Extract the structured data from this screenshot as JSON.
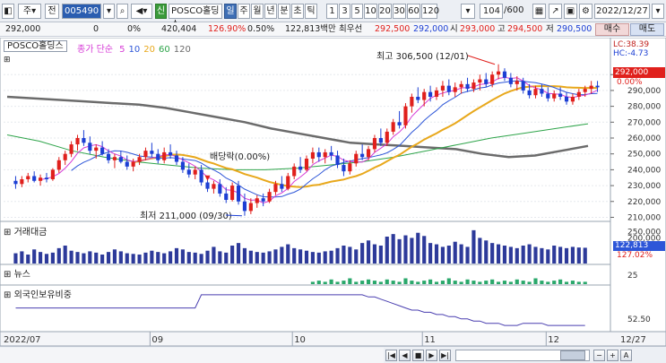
{
  "toolbar": {
    "market": "주",
    "period_kind": "전",
    "stock_code": "005490",
    "stock_name": "POSCO홀딩스",
    "new_badge": "신",
    "period_tabs": [
      "일",
      "주",
      "월",
      "년",
      "분",
      "초",
      "틱"
    ],
    "selected_period": "일",
    "interval_buttons": [
      "1",
      "3",
      "5",
      "10",
      "20",
      "30",
      "60",
      "120"
    ],
    "count": "104",
    "count_total": "/600",
    "date": "2022/12/27"
  },
  "quote": {
    "price": "292,000",
    "change": "0",
    "change_pct": "0%",
    "volume": "420,404",
    "volume_ratio": "126.90%",
    "turnover": "0.50%",
    "amount": "122,813백만",
    "best_ask_label": "최우선",
    "best_ask": "292,500",
    "best_bid": "292,000",
    "open_label": "시",
    "open": "293,000",
    "high_label": "고",
    "high": "294,500",
    "low_label": "저",
    "low": "290,500",
    "buy_label": "매수",
    "sell_label": "매도"
  },
  "price_pane": {
    "label": "POSCO홀딩스",
    "legend_prefix": "종가 단순",
    "ma_periods": [
      "5",
      "10",
      "20",
      "60",
      "120"
    ],
    "ma_colors": [
      "#d63ad6",
      "#2d56d8",
      "#e8a81c",
      "#2ea44a",
      "#6b6b6b"
    ],
    "lc": "LC:38.39",
    "hc": "HC:-4.73",
    "current_price": "292,000",
    "current_pct": "0.00%",
    "high_annotation": "최고 306,500 (12/01)",
    "low_annotation": "최저 211,000 (09/30)",
    "dividend_annotation": "배당락(0.00%)",
    "y_ticks": [
      "300,000",
      "290,000",
      "280,000",
      "270,000",
      "260,000",
      "250,000",
      "240,000",
      "230,000",
      "220,000",
      "210,000"
    ]
  },
  "volume_pane": {
    "label": "거래대금",
    "y_ticks": [
      "250,000",
      "200,000"
    ],
    "current_value": "122,813",
    "current_pct": "127.02%"
  },
  "news_pane": {
    "label": "뉴스",
    "y_ticks": [
      "25"
    ]
  },
  "foreign_pane": {
    "label": "외국인보유비중",
    "y_ticks": [
      "52.50"
    ]
  },
  "x_axis": {
    "labels": [
      "2022/07",
      "09",
      "10",
      "11",
      "12"
    ],
    "end_label": "12/27"
  },
  "chart_data": {
    "type": "candlestick",
    "title": "POSCO홀딩스",
    "ylim": [
      208000,
      312000
    ],
    "candles": [
      {
        "o": 233000,
        "h": 236000,
        "l": 228000,
        "c": 231000
      },
      {
        "o": 231000,
        "h": 236000,
        "l": 229000,
        "c": 234000
      },
      {
        "o": 234000,
        "h": 238000,
        "l": 232000,
        "c": 236000
      },
      {
        "o": 236000,
        "h": 239000,
        "l": 232000,
        "c": 233000
      },
      {
        "o": 233000,
        "h": 237000,
        "l": 230000,
        "c": 235000
      },
      {
        "o": 235000,
        "h": 238000,
        "l": 232000,
        "c": 234000
      },
      {
        "o": 234000,
        "h": 241000,
        "l": 233000,
        "c": 240000
      },
      {
        "o": 240000,
        "h": 248000,
        "l": 238000,
        "c": 246000
      },
      {
        "o": 246000,
        "h": 252000,
        "l": 243000,
        "c": 250000
      },
      {
        "o": 250000,
        "h": 258000,
        "l": 248000,
        "c": 256000
      },
      {
        "o": 256000,
        "h": 262000,
        "l": 252000,
        "c": 260000
      },
      {
        "o": 260000,
        "h": 265000,
        "l": 255000,
        "c": 257000
      },
      {
        "o": 257000,
        "h": 261000,
        "l": 250000,
        "c": 252000
      },
      {
        "o": 252000,
        "h": 256000,
        "l": 247000,
        "c": 254000
      },
      {
        "o": 254000,
        "h": 258000,
        "l": 249000,
        "c": 250000
      },
      {
        "o": 250000,
        "h": 253000,
        "l": 244000,
        "c": 246000
      },
      {
        "o": 246000,
        "h": 250000,
        "l": 241000,
        "c": 248000
      },
      {
        "o": 248000,
        "h": 252000,
        "l": 244000,
        "c": 245000
      },
      {
        "o": 245000,
        "h": 249000,
        "l": 240000,
        "c": 242000
      },
      {
        "o": 242000,
        "h": 247000,
        "l": 239000,
        "c": 245000
      },
      {
        "o": 245000,
        "h": 250000,
        "l": 243000,
        "c": 248000
      },
      {
        "o": 248000,
        "h": 254000,
        "l": 246000,
        "c": 252000
      },
      {
        "o": 252000,
        "h": 257000,
        "l": 248000,
        "c": 250000
      },
      {
        "o": 250000,
        "h": 253000,
        "l": 244000,
        "c": 246000
      },
      {
        "o": 246000,
        "h": 254000,
        "l": 244000,
        "c": 251000
      },
      {
        "o": 251000,
        "h": 256000,
        "l": 247000,
        "c": 249000
      },
      {
        "o": 249000,
        "h": 252000,
        "l": 243000,
        "c": 245000
      },
      {
        "o": 245000,
        "h": 248000,
        "l": 238000,
        "c": 240000
      },
      {
        "o": 240000,
        "h": 244000,
        "l": 235000,
        "c": 237000
      },
      {
        "o": 237000,
        "h": 242000,
        "l": 234000,
        "c": 240000
      },
      {
        "o": 240000,
        "h": 243000,
        "l": 230000,
        "c": 232000
      },
      {
        "o": 232000,
        "h": 235000,
        "l": 226000,
        "c": 228000
      },
      {
        "o": 228000,
        "h": 233000,
        "l": 225000,
        "c": 231000
      },
      {
        "o": 231000,
        "h": 234000,
        "l": 223000,
        "c": 225000
      },
      {
        "o": 225000,
        "h": 229000,
        "l": 219000,
        "c": 221000
      },
      {
        "o": 221000,
        "h": 232000,
        "l": 220000,
        "c": 230000
      },
      {
        "o": 230000,
        "h": 233000,
        "l": 218000,
        "c": 220000
      },
      {
        "o": 220000,
        "h": 225000,
        "l": 211000,
        "c": 214000
      },
      {
        "o": 214000,
        "h": 222000,
        "l": 212000,
        "c": 219000
      },
      {
        "o": 219000,
        "h": 224000,
        "l": 216000,
        "c": 222000
      },
      {
        "o": 222000,
        "h": 225000,
        "l": 217000,
        "c": 220000
      },
      {
        "o": 220000,
        "h": 228000,
        "l": 219000,
        "c": 226000
      },
      {
        "o": 226000,
        "h": 233000,
        "l": 224000,
        "c": 231000
      },
      {
        "o": 231000,
        "h": 236000,
        "l": 226000,
        "c": 228000
      },
      {
        "o": 228000,
        "h": 238000,
        "l": 227000,
        "c": 236000
      },
      {
        "o": 236000,
        "h": 244000,
        "l": 234000,
        "c": 242000
      },
      {
        "o": 242000,
        "h": 248000,
        "l": 238000,
        "c": 240000
      },
      {
        "o": 240000,
        "h": 249000,
        "l": 239000,
        "c": 247000
      },
      {
        "o": 247000,
        "h": 254000,
        "l": 244000,
        "c": 251000
      },
      {
        "o": 251000,
        "h": 254000,
        "l": 245000,
        "c": 248000
      },
      {
        "o": 248000,
        "h": 253000,
        "l": 244000,
        "c": 251000
      },
      {
        "o": 251000,
        "h": 255000,
        "l": 246000,
        "c": 249000
      },
      {
        "o": 249000,
        "h": 252000,
        "l": 241000,
        "c": 243000
      },
      {
        "o": 243000,
        "h": 247000,
        "l": 236000,
        "c": 239000
      },
      {
        "o": 239000,
        "h": 246000,
        "l": 237000,
        "c": 244000
      },
      {
        "o": 244000,
        "h": 252000,
        "l": 242000,
        "c": 250000
      },
      {
        "o": 250000,
        "h": 256000,
        "l": 246000,
        "c": 248000
      },
      {
        "o": 248000,
        "h": 255000,
        "l": 246000,
        "c": 253000
      },
      {
        "o": 253000,
        "h": 262000,
        "l": 251000,
        "c": 260000
      },
      {
        "o": 260000,
        "h": 266000,
        "l": 255000,
        "c": 257000
      },
      {
        "o": 257000,
        "h": 266000,
        "l": 255000,
        "c": 264000
      },
      {
        "o": 264000,
        "h": 272000,
        "l": 262000,
        "c": 270000
      },
      {
        "o": 270000,
        "h": 277000,
        "l": 266000,
        "c": 268000
      },
      {
        "o": 268000,
        "h": 282000,
        "l": 266000,
        "c": 280000
      },
      {
        "o": 280000,
        "h": 288000,
        "l": 276000,
        "c": 286000
      },
      {
        "o": 286000,
        "h": 292000,
        "l": 282000,
        "c": 284000
      },
      {
        "o": 284000,
        "h": 291000,
        "l": 280000,
        "c": 289000
      },
      {
        "o": 289000,
        "h": 293000,
        "l": 283000,
        "c": 286000
      },
      {
        "o": 286000,
        "h": 292000,
        "l": 284000,
        "c": 290000
      },
      {
        "o": 290000,
        "h": 296000,
        "l": 286000,
        "c": 293000
      },
      {
        "o": 293000,
        "h": 297000,
        "l": 287000,
        "c": 289000
      },
      {
        "o": 289000,
        "h": 295000,
        "l": 286000,
        "c": 292000
      },
      {
        "o": 292000,
        "h": 296000,
        "l": 288000,
        "c": 294000
      },
      {
        "o": 294000,
        "h": 298000,
        "l": 289000,
        "c": 291000
      },
      {
        "o": 291000,
        "h": 297000,
        "l": 289000,
        "c": 295000
      },
      {
        "o": 295000,
        "h": 300000,
        "l": 290000,
        "c": 297000
      },
      {
        "o": 297000,
        "h": 301000,
        "l": 292000,
        "c": 294000
      },
      {
        "o": 294000,
        "h": 302000,
        "l": 292000,
        "c": 300000
      },
      {
        "o": 300000,
        "h": 306500,
        "l": 297000,
        "c": 302000
      },
      {
        "o": 302000,
        "h": 304000,
        "l": 296000,
        "c": 298000
      },
      {
        "o": 298000,
        "h": 301000,
        "l": 292000,
        "c": 294000
      },
      {
        "o": 294000,
        "h": 299000,
        "l": 290000,
        "c": 296000
      },
      {
        "o": 296000,
        "h": 298000,
        "l": 288000,
        "c": 290000
      },
      {
        "o": 290000,
        "h": 294000,
        "l": 285000,
        "c": 287000
      },
      {
        "o": 287000,
        "h": 293000,
        "l": 285000,
        "c": 291000
      },
      {
        "o": 291000,
        "h": 294000,
        "l": 286000,
        "c": 288000
      },
      {
        "o": 288000,
        "h": 292000,
        "l": 283000,
        "c": 285000
      },
      {
        "o": 285000,
        "h": 290000,
        "l": 283000,
        "c": 288000
      },
      {
        "o": 288000,
        "h": 292000,
        "l": 284000,
        "c": 286000
      },
      {
        "o": 286000,
        "h": 289000,
        "l": 281000,
        "c": 283000
      },
      {
        "o": 283000,
        "h": 288000,
        "l": 281000,
        "c": 286000
      },
      {
        "o": 286000,
        "h": 291000,
        "l": 284000,
        "c": 289000
      },
      {
        "o": 289000,
        "h": 293000,
        "l": 286000,
        "c": 291000
      },
      {
        "o": 291000,
        "h": 296000,
        "l": 288000,
        "c": 293000
      },
      {
        "o": 293000,
        "h": 296000,
        "l": 289000,
        "c": 292000
      }
    ],
    "ma120": [
      286000,
      285000,
      284000,
      283000,
      282000,
      281000,
      279000,
      276000,
      273000,
      270000,
      266000,
      263000,
      260000,
      257000,
      256000,
      255000,
      254000,
      253000,
      250000,
      248000,
      249000,
      252000,
      255000
    ],
    "ma60": [
      262000,
      258000,
      252000,
      248000,
      245000,
      243000,
      241000,
      240000,
      240000,
      241000,
      243000,
      245000,
      248000,
      252000,
      256000,
      260000,
      263000,
      266000,
      269000
    ],
    "volume": [
      80,
      95,
      70,
      110,
      90,
      75,
      85,
      120,
      140,
      100,
      90,
      80,
      95,
      85,
      70,
      90,
      110,
      95,
      80,
      75,
      70,
      85,
      100,
      90,
      80,
      95,
      120,
      110,
      90,
      85,
      75,
      100,
      130,
      95,
      85,
      140,
      160,
      120,
      100,
      90,
      85,
      95,
      110,
      130,
      150,
      120,
      110,
      100,
      90,
      85,
      95,
      100,
      120,
      140,
      130,
      110,
      160,
      180,
      150,
      140,
      210,
      230,
      190,
      220,
      200,
      240,
      215,
      160,
      150,
      130,
      140,
      170,
      150,
      130,
      260,
      200,
      180,
      160,
      150,
      140,
      130,
      120,
      140,
      150,
      130,
      120,
      110,
      140,
      130,
      120,
      130,
      125,
      123
    ],
    "news": [
      0,
      0,
      0,
      0,
      0,
      0,
      0,
      0,
      0,
      0,
      0,
      0,
      0,
      0,
      0,
      0,
      0,
      0,
      0,
      0,
      0,
      0,
      0,
      0,
      0,
      0,
      0,
      0,
      0,
      0,
      0,
      0,
      0,
      0,
      0,
      0,
      0,
      0,
      0,
      0,
      0,
      0,
      0,
      0,
      0,
      0,
      0,
      0,
      2,
      3,
      2,
      4,
      2,
      3,
      5,
      2,
      3,
      4,
      3,
      2,
      4,
      3,
      2,
      5,
      3,
      2,
      3,
      4,
      2,
      3,
      5,
      3,
      2,
      4,
      3,
      2,
      3,
      4,
      2,
      3,
      2,
      4,
      3,
      2,
      5,
      3,
      2,
      3,
      4,
      2,
      3,
      2,
      2
    ],
    "foreign_hold": [
      53.0,
      53.0,
      53.0,
      53.0,
      53.0,
      53.0,
      53.0,
      53.0,
      53.0,
      53.0,
      53.0,
      53.0,
      53.0,
      53.0,
      53.0,
      53.0,
      53.0,
      53.0,
      53.0,
      53.0,
      53.0,
      53.0,
      53.0,
      53.0,
      53.0,
      53.0,
      53.0,
      53.0,
      53.0,
      53.0,
      53.6,
      53.6,
      53.6,
      53.6,
      53.6,
      53.6,
      53.6,
      53.6,
      53.6,
      53.6,
      53.6,
      53.6,
      53.6,
      53.6,
      53.6,
      53.6,
      53.6,
      53.6,
      53.6,
      53.6,
      53.6,
      53.6,
      53.6,
      53.6,
      53.6,
      53.6,
      53.6,
      53.5,
      53.5,
      53.4,
      53.3,
      53.2,
      53.1,
      53.0,
      52.9,
      52.9,
      52.8,
      52.8,
      52.7,
      52.7,
      52.6,
      52.6,
      52.5,
      52.5,
      52.4,
      52.4,
      52.3,
      52.3,
      52.3,
      52.2,
      52.2,
      52.2,
      52.3,
      52.3,
      52.3,
      52.3,
      52.2,
      52.2,
      52.2,
      52.2,
      52.2,
      52.2,
      52.2
    ]
  }
}
